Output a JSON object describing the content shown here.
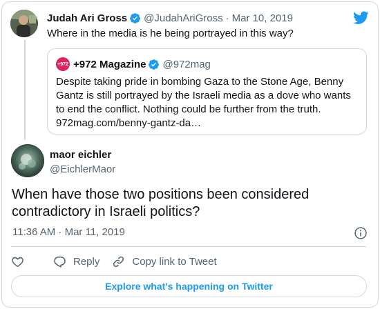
{
  "parent_tweet": {
    "name": "Judah Ari Gross",
    "handle": "@JudahAriGross",
    "separator": "·",
    "date": "Mar 10, 2019",
    "text": "Where in the media is he being portrayed in this way?"
  },
  "quoted_tweet": {
    "avatar_text": "+972",
    "name": "+972 Magazine",
    "handle": "@972mag",
    "lines": [
      "Despite taking pride in bombing Gaza to the Stone Age, Benny",
      "Gantz is still portrayed by the Israeli media as a dove who wants",
      "to end the conflict. Nothing could be further from the truth.",
      "972mag.com/benny-gantz-da…"
    ]
  },
  "main_tweet": {
    "name": "maor eichler",
    "handle": "@EichlerMaor",
    "lines": [
      "When have those two positions been considered",
      "contradictory in Israeli politics?"
    ],
    "timestamp": "11:36 AM · Mar 11, 2019"
  },
  "actions": {
    "reply_label": "Reply",
    "copy_link_label": "Copy link to Tweet"
  },
  "explore_label": "Explore what's happening on Twitter",
  "colors": {
    "accent": "#1d9bf0",
    "verified": "#1d9bf0",
    "muted_text": "#536471",
    "border": "#cfd9de",
    "magazine_badge": "#e0245e"
  },
  "icons": [
    "twitter-bird-icon",
    "verified-badge-icon",
    "info-icon",
    "heart-icon",
    "reply-icon",
    "link-icon"
  ]
}
